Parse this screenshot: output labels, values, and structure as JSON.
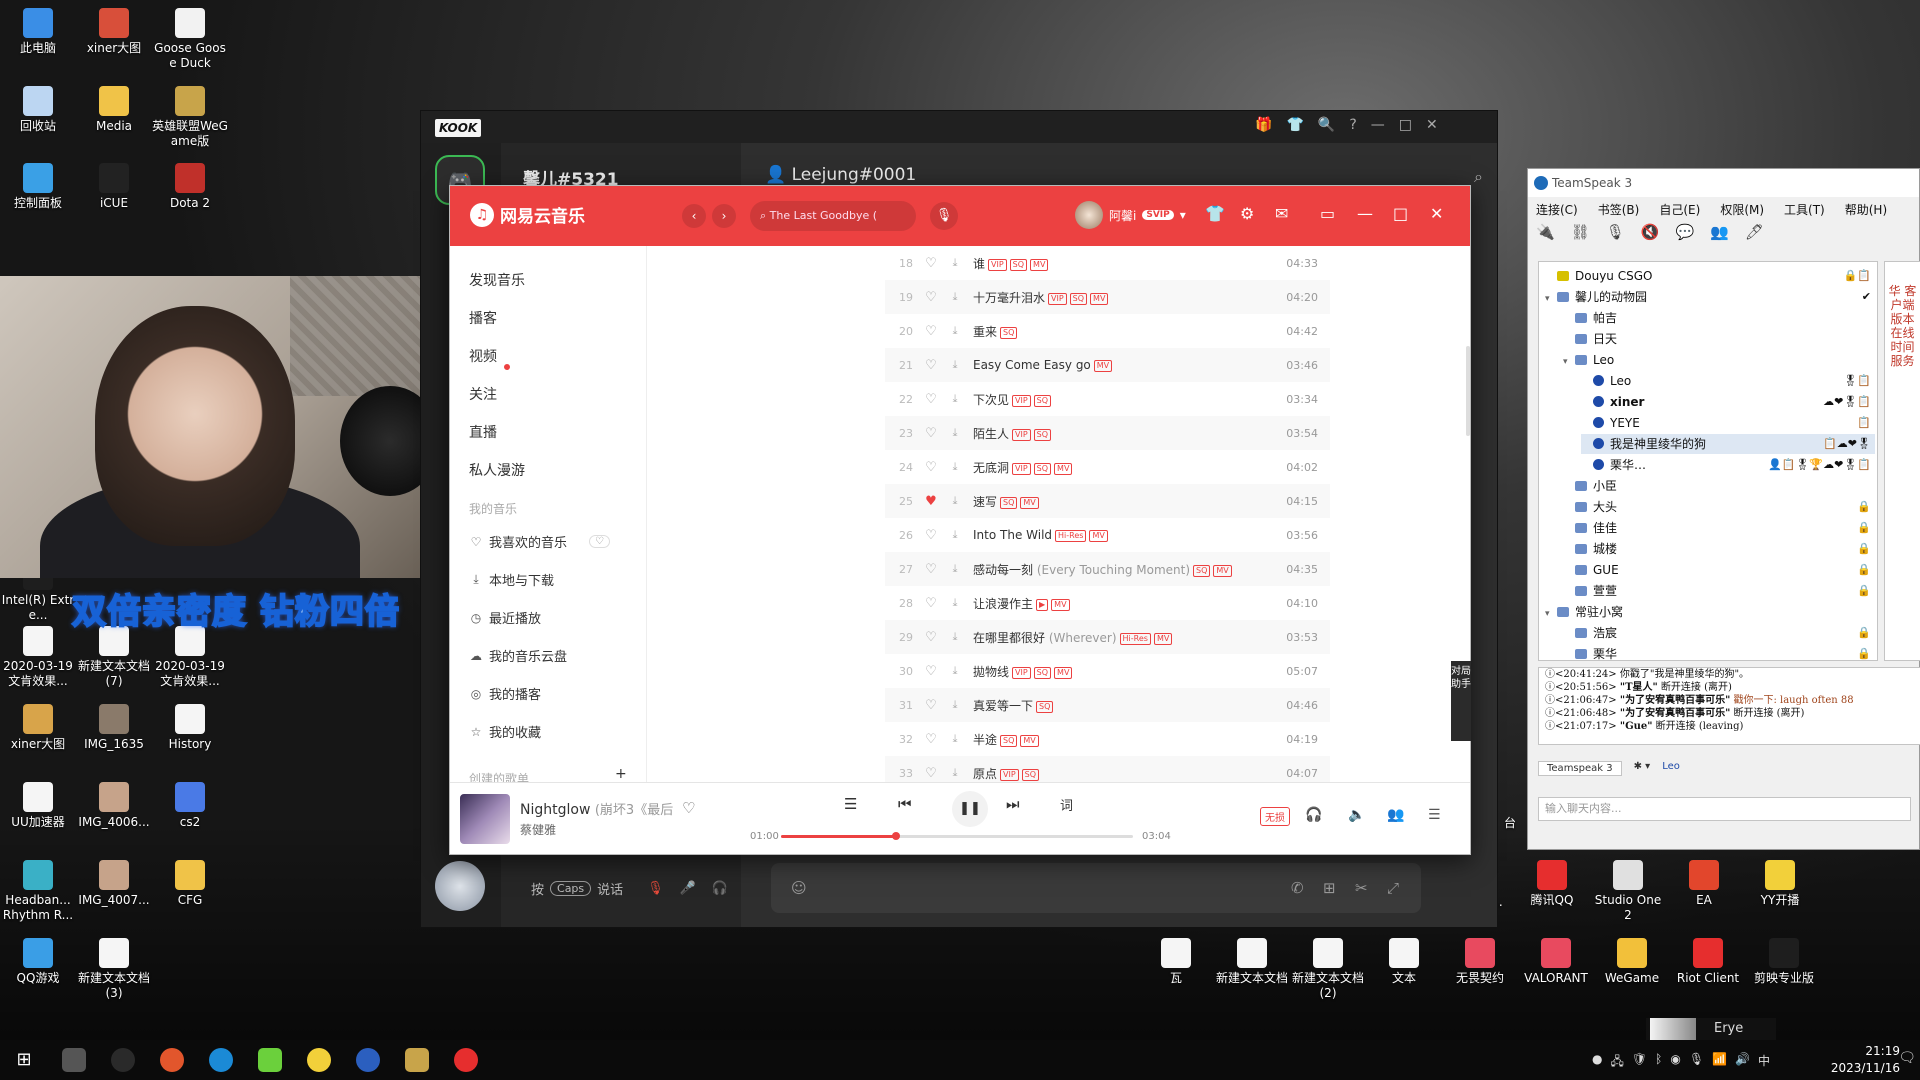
{
  "desktop": {
    "icons": [
      {
        "label": "此电脑",
        "color": "#3a8ee6"
      },
      {
        "label": "xiner大图",
        "color": "#d84f3a"
      },
      {
        "label": "Goose Goose Duck",
        "color": "#f2f2f2"
      },
      {
        "label": "回收站",
        "color": "#bcd6f2"
      },
      {
        "label": "Media",
        "color": "#f0c348"
      },
      {
        "label": "英雄联盟WeGame版",
        "color": "#c8a44a"
      },
      {
        "label": "控制面板",
        "color": "#3aa0e6"
      },
      {
        "label": "iCUE",
        "color": "#222222"
      },
      {
        "label": "Dota 2",
        "color": "#c0302a"
      },
      {
        "label": "2020-03-19 文肯效果...",
        "color": "#f5f5f5"
      },
      {
        "label": "新建文本文档 (7)",
        "color": "#f5f5f5"
      },
      {
        "label": "2020-03-19 文肯效果...",
        "color": "#f5f5f5"
      },
      {
        "label": "xiner大图",
        "color": "#d8a44a"
      },
      {
        "label": "IMG_1635",
        "color": "#8a7a6a"
      },
      {
        "label": "History",
        "color": "#f5f5f5"
      },
      {
        "label": "UU加速器",
        "color": "#f5f5f5"
      },
      {
        "label": "IMG_4006...",
        "color": "#c6a38a"
      },
      {
        "label": "cs2",
        "color": "#4a7ae6"
      },
      {
        "label": "Headban... Rhythm R...",
        "color": "#3ab0c6"
      },
      {
        "label": "IMG_4007...",
        "color": "#c6a38a"
      },
      {
        "label": "CFG",
        "color": "#f0c348"
      },
      {
        "label": "QQ游戏",
        "color": "#3a9ee6"
      },
      {
        "label": "新建文本文档 (3)",
        "color": "#f5f5f5"
      },
      {
        "label": "Intel(R) Extre...",
        "color": "#1e1e1e"
      },
      {
        "label": "腾讯QQ",
        "color": "#e62e2e"
      },
      {
        "label": "Studio One 2",
        "color": "#e0e0e0"
      },
      {
        "label": "EA",
        "color": "#e2462c"
      },
      {
        "label": "YY开播",
        "color": "#f2d03a"
      },
      {
        "label": "瓦",
        "color": "#f5f5f5"
      },
      {
        "label": "新建文本文档",
        "color": "#f5f5f5"
      },
      {
        "label": "新建文本文档 (2)",
        "color": "#f5f5f5"
      },
      {
        "label": "文本",
        "color": "#f5f5f5"
      },
      {
        "label": "无畏契约",
        "color": "#e84a5f"
      },
      {
        "label": "VALORANT",
        "color": "#e84a5f"
      },
      {
        "label": "WeGame",
        "color": "#f2c03a"
      },
      {
        "label": "Riot Client",
        "color": "#e62e2e"
      },
      {
        "label": "剪映专业版",
        "color": "#1e1e1e"
      }
    ],
    "partial_labels": [
      "r...",
      "台"
    ]
  },
  "stream_overlay": {
    "banner": "双倍亲密度 钻粉四倍"
  },
  "kook": {
    "logo": "KOOK",
    "channel_title": "馨儿#5321",
    "chat_title": "Leejung#0001",
    "voice_prefix": "按",
    "voice_key": "Caps",
    "voice_suffix": "说话",
    "window_controls": [
      "🎁",
      "👕",
      "🔍",
      "?",
      "—",
      "□",
      "✕"
    ]
  },
  "netease": {
    "app_name": "网易云音乐",
    "search_placeholder": "The Last Goodbye (",
    "user_name": "阿馨i",
    "vip_badge": "SVIP",
    "sidebar": [
      {
        "label": "发现音乐"
      },
      {
        "label": "播客"
      },
      {
        "label": "视频"
      },
      {
        "label": "关注"
      },
      {
        "label": "直播"
      },
      {
        "label": "私人漫游"
      }
    ],
    "my_music_section": "我的音乐",
    "my_music": [
      {
        "label": "我喜欢的音乐",
        "icon": "♡"
      },
      {
        "label": "本地与下载",
        "icon": "⤓"
      },
      {
        "label": "最近播放",
        "icon": "◷"
      },
      {
        "label": "我的音乐云盘",
        "icon": "☁"
      },
      {
        "label": "我的播客",
        "icon": "◎"
      },
      {
        "label": "我的收藏",
        "icon": "☆"
      }
    ],
    "created_playlists_section": "创建的歌单",
    "tracks": [
      {
        "no": "18",
        "title": "谁",
        "alias": "",
        "tags": [
          "VIP",
          "SQ",
          "MV"
        ],
        "liked": false,
        "duration": "04:33"
      },
      {
        "no": "19",
        "title": "十万毫升泪水",
        "alias": "",
        "tags": [
          "VIP",
          "SQ",
          "MV"
        ],
        "liked": false,
        "duration": "04:20"
      },
      {
        "no": "20",
        "title": "重来",
        "alias": "",
        "tags": [
          "SQ"
        ],
        "liked": false,
        "duration": "04:42"
      },
      {
        "no": "21",
        "title": "Easy Come Easy go",
        "alias": "",
        "tags": [
          "MV"
        ],
        "liked": false,
        "duration": "03:46"
      },
      {
        "no": "22",
        "title": "下次见",
        "alias": "",
        "tags": [
          "VIP",
          "SQ"
        ],
        "liked": false,
        "duration": "03:34"
      },
      {
        "no": "23",
        "title": "陌生人",
        "alias": "",
        "tags": [
          "VIP",
          "SQ"
        ],
        "liked": false,
        "duration": "03:54"
      },
      {
        "no": "24",
        "title": "无底洞",
        "alias": "",
        "tags": [
          "VIP",
          "SQ",
          "MV"
        ],
        "liked": false,
        "duration": "04:02"
      },
      {
        "no": "25",
        "title": "速写",
        "alias": "",
        "tags": [
          "SQ",
          "MV"
        ],
        "liked": true,
        "duration": "04:15"
      },
      {
        "no": "26",
        "title": "Into The Wild",
        "alias": "",
        "tags": [
          "Hi-Res",
          "MV"
        ],
        "liked": false,
        "duration": "03:56"
      },
      {
        "no": "27",
        "title": "感动每一刻",
        "alias": "(Every Touching Moment)",
        "tags": [
          "SQ",
          "MV"
        ],
        "liked": false,
        "duration": "04:35"
      },
      {
        "no": "28",
        "title": "让浪漫作主",
        "alias": "",
        "tags": [
          "▶",
          "MV"
        ],
        "liked": false,
        "duration": "04:10"
      },
      {
        "no": "29",
        "title": "在哪里都很好",
        "alias": "(Wherever)",
        "tags": [
          "Hi-Res",
          "MV"
        ],
        "liked": false,
        "duration": "03:53"
      },
      {
        "no": "30",
        "title": "拋物线",
        "alias": "",
        "tags": [
          "VIP",
          "SQ",
          "MV"
        ],
        "liked": false,
        "duration": "05:07"
      },
      {
        "no": "31",
        "title": "真爱等一下",
        "alias": "",
        "tags": [
          "SQ"
        ],
        "liked": false,
        "duration": "04:46"
      },
      {
        "no": "32",
        "title": "半途",
        "alias": "",
        "tags": [
          "SQ",
          "MV"
        ],
        "liked": false,
        "duration": "04:19"
      },
      {
        "no": "33",
        "title": "原点",
        "alias": "",
        "tags": [
          "VIP",
          "SQ"
        ],
        "liked": false,
        "duration": "04:07"
      }
    ],
    "assistant_tab": "对局助手",
    "player": {
      "song": "Nightglow",
      "alias": "(崩坏3《最后",
      "artist": "蔡健雅",
      "elapsed": "01:00",
      "total": "03:04",
      "progress": 0.326,
      "lyrics_button": "词",
      "quality": "无损"
    }
  },
  "teamspeak": {
    "title": "TeamSpeak 3",
    "menu": [
      "连接(C)",
      "书签(B)",
      "自己(E)",
      "权限(M)",
      "工具(T)",
      "帮助(H)"
    ],
    "tree": [
      {
        "label": "Douyu CSGO",
        "level": 0,
        "kind": "server",
        "expanded": false,
        "bold": false,
        "selected": false,
        "badges": "🔒📋"
      },
      {
        "label": "馨儿的动物园",
        "level": 0,
        "kind": "channel",
        "expanded": true,
        "bold": false,
        "selected": false,
        "badges": "✔"
      },
      {
        "label": "帕吉",
        "level": 1,
        "kind": "channel",
        "expanded": false,
        "bold": false,
        "selected": false,
        "badges": ""
      },
      {
        "label": "日天",
        "level": 1,
        "kind": "channel",
        "expanded": false,
        "bold": false,
        "selected": false,
        "badges": ""
      },
      {
        "label": "Leo",
        "level": 1,
        "kind": "channel",
        "expanded": true,
        "bold": false,
        "selected": false,
        "badges": ""
      },
      {
        "label": "Leo",
        "level": 2,
        "kind": "user",
        "expanded": false,
        "bold": false,
        "selected": false,
        "badges": "🎖📋"
      },
      {
        "label": "xiner",
        "level": 2,
        "kind": "user",
        "expanded": false,
        "bold": true,
        "selected": false,
        "badges": "☁❤🎖📋"
      },
      {
        "label": "YEYE",
        "level": 2,
        "kind": "user",
        "expanded": false,
        "bold": false,
        "selected": false,
        "badges": "📋"
      },
      {
        "label": "我是神里绫华的狗",
        "level": 2,
        "kind": "user",
        "expanded": false,
        "bold": false,
        "selected": true,
        "badges": "📋☁❤🎖"
      },
      {
        "label": "栗华…",
        "level": 2,
        "kind": "user",
        "expanded": false,
        "bold": false,
        "selected": false,
        "badges": "👤📋🎖🏆☁❤🎖📋"
      },
      {
        "label": "小臣",
        "level": 1,
        "kind": "channel",
        "expanded": false,
        "bold": false,
        "selected": false,
        "badges": ""
      },
      {
        "label": "大头",
        "level": 1,
        "kind": "channel",
        "expanded": false,
        "bold": false,
        "selected": false,
        "badges": "🔒"
      },
      {
        "label": "佳佳",
        "level": 1,
        "kind": "channel",
        "expanded": false,
        "bold": false,
        "selected": false,
        "badges": "🔒"
      },
      {
        "label": "城楼",
        "level": 1,
        "kind": "channel",
        "expanded": false,
        "bold": false,
        "selected": false,
        "badges": "🔒"
      },
      {
        "label": "GUE",
        "level": 1,
        "kind": "channel",
        "expanded": false,
        "bold": false,
        "selected": false,
        "badges": "🔒"
      },
      {
        "label": "萱萱",
        "level": 1,
        "kind": "channel",
        "expanded": false,
        "bold": false,
        "selected": false,
        "badges": "🔒"
      },
      {
        "label": "常驻小窝",
        "level": 0,
        "kind": "channel",
        "expanded": true,
        "bold": false,
        "selected": false,
        "badges": ""
      },
      {
        "label": "浩宸",
        "level": 1,
        "kind": "channel",
        "expanded": false,
        "bold": false,
        "selected": false,
        "badges": "🔒"
      },
      {
        "label": "栗华",
        "level": 1,
        "kind": "channel",
        "expanded": false,
        "bold": false,
        "selected": false,
        "badges": "🔒"
      }
    ],
    "side_strip": "华 客户端版本在线时间 服务",
    "log": [
      {
        "time": "<20:41:24>",
        "name": "",
        "text": "你戳了\"我是神里绫华的狗\"。",
        "red": ""
      },
      {
        "time": "<20:51:56>",
        "name": "\"T星人\"",
        "text": "断开连接 (离开)",
        "red": ""
      },
      {
        "time": "<21:06:47>",
        "name": "\"为了安宥真鸭百事可乐\"",
        "text": "戳你一下: laugh often 88",
        "red": "戳你一下: laugh often 88"
      },
      {
        "time": "<21:06:48>",
        "name": "\"为了安宥真鸭百事可乐\"",
        "text": "断开连接 (离开)",
        "red": ""
      },
      {
        "time": "<21:07:17>",
        "name": "\"Gue\"",
        "text": "断开连接 (leaving)",
        "red": ""
      }
    ],
    "tabs": [
      "Teamspeak 3",
      "Leo"
    ],
    "input_placeholder": "输入聊天内容..."
  },
  "taskbar": {
    "time": "21:19",
    "date": "2023/11/16",
    "notification_user": "Erye",
    "ime": "中"
  }
}
